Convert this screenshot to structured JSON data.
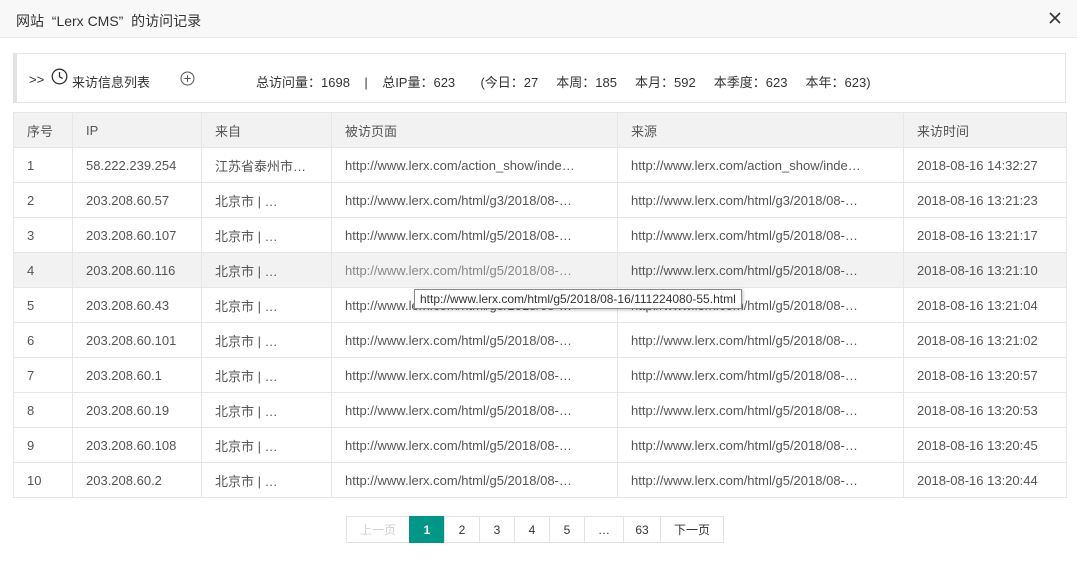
{
  "dialog": {
    "title": "网站  “Lerx CMS”  的访问记录"
  },
  "infobar": {
    "arrows": ">>",
    "list_title": "来访信息列表",
    "stats": "总访问量：1698    |    总IP量：623       (今日：27     本周：185     本月：592     本季度：623     本年：623)"
  },
  "table": {
    "headers": [
      "序号",
      "IP",
      "来自",
      "被访页面",
      "来源",
      "来访时间"
    ],
    "rows": [
      [
        "1",
        "58.222.239.254",
        "江苏省泰州市…",
        "http://www.lerx.com/action_show/inde…",
        "http://www.lerx.com/action_show/inde…",
        "2018-08-16 14:32:27"
      ],
      [
        "2",
        "203.208.60.57",
        "北京市 | …",
        "http://www.lerx.com/html/g3/2018/08-…",
        "http://www.lerx.com/html/g3/2018/08-…",
        "2018-08-16 13:21:23"
      ],
      [
        "3",
        "203.208.60.107",
        "北京市 | …",
        "http://www.lerx.com/html/g5/2018/08-…",
        "http://www.lerx.com/html/g5/2018/08-…",
        "2018-08-16 13:21:17"
      ],
      [
        "4",
        "203.208.60.116",
        "北京市 | …",
        "http://www.lerx.com/html/g5/2018/08-…",
        "http://www.lerx.com/html/g5/2018/08-…",
        "2018-08-16 13:21:10"
      ],
      [
        "5",
        "203.208.60.43",
        "北京市 | …",
        "http://www.lerx.com/html/g5/2018/08-…",
        "http://www.lerx.com/html/g5/2018/08-…",
        "2018-08-16 13:21:04"
      ],
      [
        "6",
        "203.208.60.101",
        "北京市 | …",
        "http://www.lerx.com/html/g5/2018/08-…",
        "http://www.lerx.com/html/g5/2018/08-…",
        "2018-08-16 13:21:02"
      ],
      [
        "7",
        "203.208.60.1",
        "北京市 | …",
        "http://www.lerx.com/html/g5/2018/08-…",
        "http://www.lerx.com/html/g5/2018/08-…",
        "2018-08-16 13:20:57"
      ],
      [
        "8",
        "203.208.60.19",
        "北京市 | …",
        "http://www.lerx.com/html/g5/2018/08-…",
        "http://www.lerx.com/html/g5/2018/08-…",
        "2018-08-16 13:20:53"
      ],
      [
        "9",
        "203.208.60.108",
        "北京市 | …",
        "http://www.lerx.com/html/g5/2018/08-…",
        "http://www.lerx.com/html/g5/2018/08-…",
        "2018-08-16 13:20:45"
      ],
      [
        "10",
        "203.208.60.2",
        "北京市 | …",
        "http://www.lerx.com/html/g5/2018/08-…",
        "http://www.lerx.com/html/g5/2018/08-…",
        "2018-08-16 13:20:44"
      ]
    ],
    "hovered_row": 4
  },
  "tooltip": {
    "text": "http://www.lerx.com/html/g5/2018/08-16/111224080-55.html"
  },
  "pagination": {
    "prev": "上一页",
    "pages": [
      "1",
      "2",
      "3",
      "4",
      "5"
    ],
    "ellipsis": "…",
    "last": "63",
    "next": "下一页",
    "current": "1"
  },
  "icons": {
    "close": "close-icon",
    "clock": "clock-icon",
    "add": "plus-circle-icon"
  },
  "colors": {
    "accent": "#009688",
    "header_bg": "#f2f2f2",
    "border": "#e6e6e6"
  }
}
